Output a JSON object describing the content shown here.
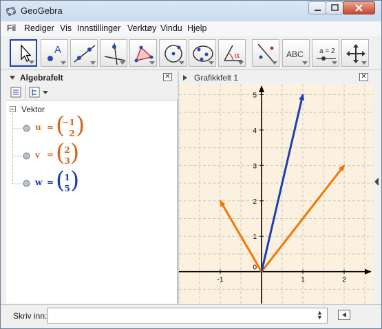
{
  "window": {
    "title": "GeoGebra"
  },
  "menu": [
    "Fil",
    "Rediger",
    "Vis",
    "Innstillinger",
    "Verktøy",
    "Vindu",
    "Hjelp"
  ],
  "toolbar": {
    "tools": [
      {
        "name": "move-tool",
        "label": ""
      },
      {
        "name": "point-tool",
        "label": "A"
      },
      {
        "name": "line-tool",
        "label": ""
      },
      {
        "name": "perpendicular-tool",
        "label": ""
      },
      {
        "name": "polygon-tool",
        "label": ""
      },
      {
        "name": "circle-tool",
        "label": ""
      },
      {
        "name": "conic-tool",
        "label": ""
      },
      {
        "name": "angle-tool",
        "label": "α"
      },
      {
        "name": "reflect-tool",
        "label": ""
      },
      {
        "name": "text-tool",
        "label": "ABC"
      },
      {
        "name": "slider-tool",
        "label": "a = 2"
      },
      {
        "name": "move-view-tool",
        "label": ""
      }
    ]
  },
  "algebra": {
    "title": "Algebrafelt",
    "folder": "Vektor",
    "objects": [
      {
        "name": "u",
        "eq": "=",
        "x": "−1",
        "y": "2",
        "color": "#d2691e"
      },
      {
        "name": "v",
        "eq": "=",
        "x": "2",
        "y": "3",
        "color": "#d2691e"
      },
      {
        "name": "w",
        "eq": "=",
        "x": "1",
        "y": "5",
        "color": "#1c3fb0"
      }
    ]
  },
  "graphics": {
    "title": "Grafikkfelt 1",
    "x_ticks": [
      "-1",
      "0",
      "1",
      "2"
    ],
    "y_ticks": [
      "1",
      "2",
      "3",
      "4",
      "5"
    ],
    "origin_label": "0"
  },
  "chart_data": {
    "type": "vector",
    "xlim": [
      -2.0,
      2.7
    ],
    "ylim": [
      -0.9,
      5.3
    ],
    "grid": true,
    "series": [
      {
        "name": "u",
        "x": [
          0,
          -1
        ],
        "y": [
          0,
          2
        ],
        "color": "#f07800"
      },
      {
        "name": "v",
        "x": [
          0,
          2
        ],
        "y": [
          0,
          3
        ],
        "color": "#f07800"
      },
      {
        "name": "w",
        "x": [
          0,
          1
        ],
        "y": [
          0,
          5
        ],
        "color": "#1c3fb0"
      }
    ]
  },
  "input": {
    "label": "Skriv inn:",
    "value": ""
  }
}
